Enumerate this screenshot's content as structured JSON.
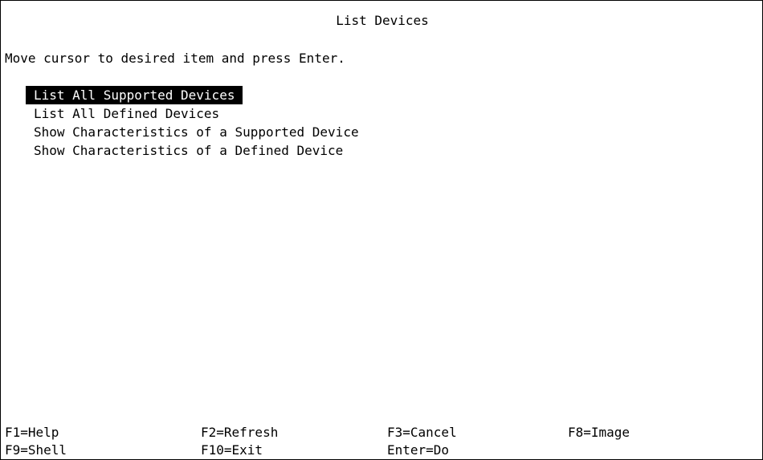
{
  "screen": {
    "title": "List Devices",
    "instruction": "Move cursor to desired item and press Enter."
  },
  "menu": {
    "selected_index": 0,
    "items": [
      {
        "label": "List All Supported Devices"
      },
      {
        "label": "List All Defined Devices"
      },
      {
        "label": "Show Characteristics of a Supported Device"
      },
      {
        "label": "Show Characteristics of a Defined Device"
      }
    ]
  },
  "function_keys": {
    "row1": [
      {
        "label": "F1=Help"
      },
      {
        "label": "F2=Refresh"
      },
      {
        "label": "F3=Cancel"
      },
      {
        "label": "F8=Image"
      }
    ],
    "row2": [
      {
        "label": "F9=Shell"
      },
      {
        "label": "F10=Exit"
      },
      {
        "label": "Enter=Do"
      }
    ]
  },
  "colors": {
    "background": "#ffffff",
    "text": "#000000",
    "selection_background": "#000000",
    "selection_text": "#ffffff"
  }
}
